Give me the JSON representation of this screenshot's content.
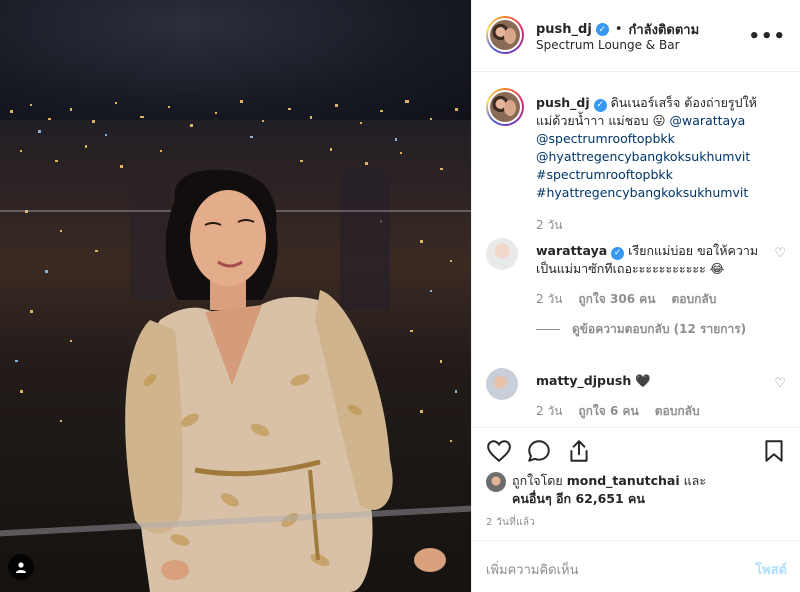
{
  "photo": {
    "alt_icons": [
      "user-tag-icon"
    ]
  },
  "header": {
    "username": "push_dj",
    "separator": "•",
    "follow_label": "กำลังติดตาม",
    "location": "Spectrum Lounge & Bar",
    "more_icon": "more-icon"
  },
  "caption": {
    "username": "push_dj",
    "text_before": "ดินเนอร์เสร็จ ต้องถ่ายรูปให้แม่ด้วยน้ำาา แม่ชอบ 😛 ",
    "mention_1": "@warattaya",
    "mention_2": "@spectrumrooftopbkk",
    "mention_3": "@hyattregencybangkoksukhumvit",
    "hashtag_1": "#spectrumrooftopbkk",
    "hashtag_2": "#hyattregencybangkoksukhumvit",
    "time": "2 วัน"
  },
  "comments": [
    {
      "username": "warattaya",
      "text": "เรียกแม่บ่อย ขอให้ความเป็นแม่มาซักทีเถอะะะะะะะะะะะ 😂",
      "time": "2 วัน",
      "likes": "ถูกใจ 306 คน",
      "reply": "ตอบกลับ",
      "view_replies": "ดูข้อความตอบกลับ (12 รายการ)"
    },
    {
      "username": "matty_djpush",
      "text": "🖤",
      "time": "2 วัน",
      "likes": "ถูกใจ 6 คน",
      "reply": "ตอบกลับ"
    }
  ],
  "likes": {
    "prefix": "ถูกใจโดย ",
    "liker": "mond_tanutchai",
    "middle": " และ ",
    "others": "คนอื่นๆ อีก 62,651 คน"
  },
  "time_ago": "2 วันที่แล้ว",
  "comment_box": {
    "placeholder": "เพิ่มความคิดเห็น",
    "post_label": "โพสต์"
  },
  "colors": {
    "verified": "#3897f0",
    "link": "#003569",
    "muted": "#8e8e8e",
    "post_disabled": "#b2dffc"
  }
}
